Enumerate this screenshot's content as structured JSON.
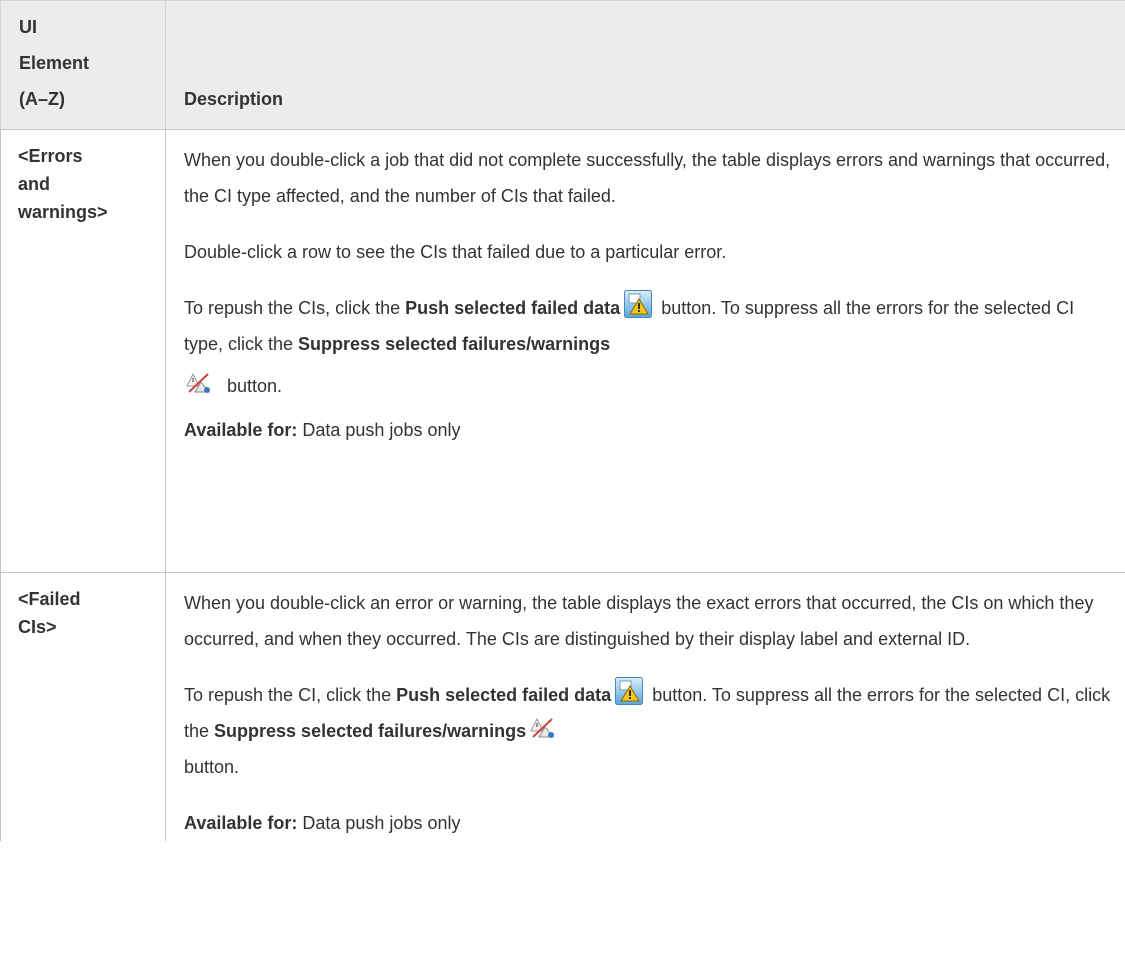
{
  "header": {
    "col1_line1": "UI",
    "col1_line2": "Element",
    "col1_line3": "(A–Z)",
    "col2": "Description"
  },
  "rows": [
    {
      "element_line1": "<Errors",
      "element_line2": "and",
      "element_line3": "warnings>",
      "p1": "When you double-click a job that did not complete successfully, the table displays errors and warnings that occurred, the CI type affected, and the number of CIs that failed.",
      "p2": "Double-click a row to see the CIs that failed due to a particular error.",
      "p3_a": "To repush the CIs, click the ",
      "p3_push_label": "Push selected failed data",
      "p3_b": " button. To suppress all the errors for the selected CI type, click the ",
      "p3_suppress_label": "Suppress selected failures/warnings",
      "p3_c": " button.",
      "avail_label": "Available for:",
      "avail_value": " Data push jobs only"
    },
    {
      "element_line1": "<Failed",
      "element_line2": "CIs>",
      "p1": "When you double-click an error or warning, the table displays the exact errors that occurred, the CIs on which they occurred, and when they occurred. The CIs are distinguished by their display label and external ID.",
      "p3_a": "To repush the CI, click the ",
      "p3_push_label": "Push selected failed data",
      "p3_b": " button. To suppress all the errors for the selected CI, click the ",
      "p3_suppress_label": "Suppress selected failures/warnings",
      "p3_c": "button.",
      "avail_label": "Available for:",
      "avail_value": " Data push jobs only"
    }
  ],
  "icons": {
    "push": "push-failed-data-icon",
    "suppress": "suppress-failures-icon"
  },
  "colors": {
    "header_bg": "#ececec",
    "border": "#c4c4c4",
    "text": "#333333"
  }
}
